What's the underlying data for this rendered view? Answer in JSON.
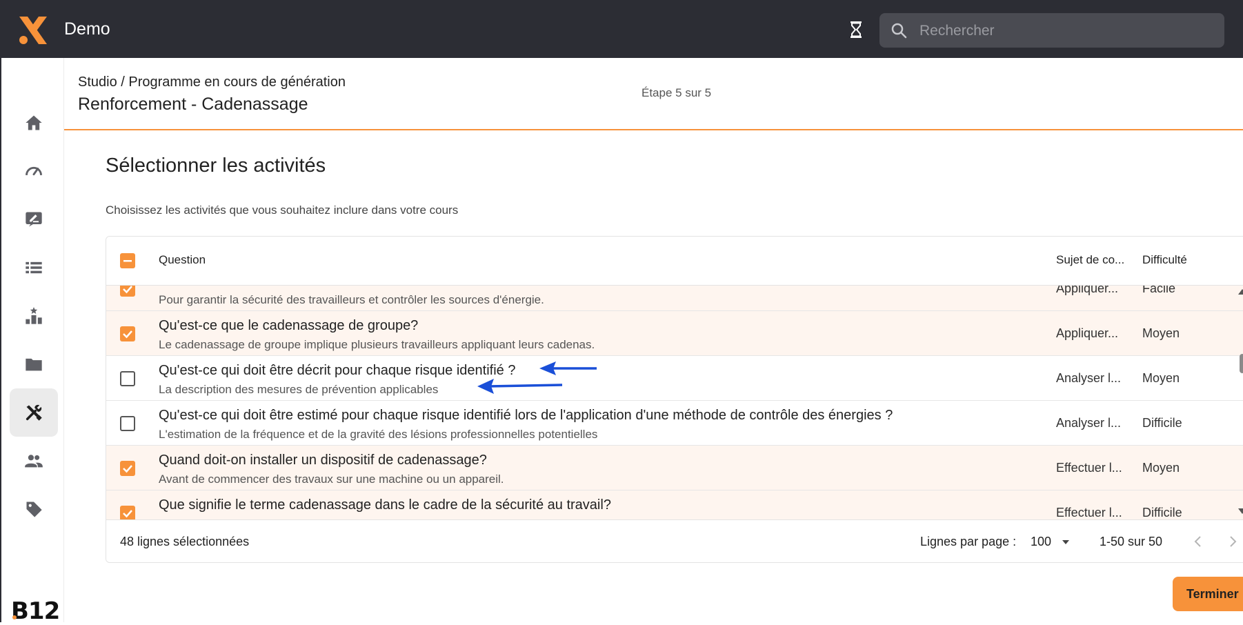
{
  "colors": {
    "accent": "#f7923a",
    "topbar": "#2c2d34",
    "annotation_arrow": "#1a4fd8",
    "selected_row": "#fef5ef"
  },
  "topbar": {
    "app_title": "Demo",
    "search_placeholder": "Rechercher",
    "icons": [
      "app-logo",
      "hourglass-icon",
      "search-icon"
    ]
  },
  "sidebar": {
    "items": [
      {
        "icon": "home-icon",
        "active": false
      },
      {
        "icon": "dashboard-gauge-icon",
        "active": false
      },
      {
        "icon": "edit-note-icon",
        "active": false
      },
      {
        "icon": "list-icon",
        "active": false
      },
      {
        "icon": "leaderboard-icon",
        "active": false
      },
      {
        "icon": "folder-icon",
        "active": false
      },
      {
        "icon": "tools-icon",
        "active": true
      },
      {
        "icon": "people-icon",
        "active": false
      },
      {
        "icon": "tag-icon",
        "active": false
      }
    ],
    "brand": "B12"
  },
  "header": {
    "breadcrumb": "Studio / Programme en cours de génération",
    "title": "Renforcement - Cadenassage",
    "step": "Étape 5 sur 5"
  },
  "main": {
    "section_title": "Sélectionner les activités",
    "section_desc": "Choisissez les activités que vous souhaitez inclure dans votre cours"
  },
  "table": {
    "columns": {
      "question": "Question",
      "subject": "Sujet de co...",
      "difficulty": "Difficulté"
    },
    "rows": [
      {
        "title": "",
        "desc": "Pour garantir la sécurité des travailleurs et contrôler les sources d'énergie.",
        "subject": "Appliquer...",
        "difficulty": "Facile",
        "selected": true
      },
      {
        "title": "Qu'est-ce que le cadenassage de groupe?",
        "desc": "Le cadenassage de groupe implique plusieurs travailleurs appliquant leurs cadenas.",
        "subject": "Appliquer...",
        "difficulty": "Moyen",
        "selected": true
      },
      {
        "title": "Qu'est-ce qui doit être décrit pour chaque risque identifié ?",
        "desc": "La description des mesures de prévention applicables",
        "subject": "Analyser l...",
        "difficulty": "Moyen",
        "selected": false
      },
      {
        "title": "Qu'est-ce qui doit être estimé pour chaque risque identifié lors de l'application d'une méthode de contrôle des énergies ?",
        "desc": "L'estimation de la fréquence et de la gravité des lésions professionnelles potentielles",
        "subject": "Analyser l...",
        "difficulty": "Difficile",
        "selected": false
      },
      {
        "title": "Quand doit-on installer un dispositif de cadenassage?",
        "desc": "Avant de commencer des travaux sur une machine ou un appareil.",
        "subject": "Effectuer l...",
        "difficulty": "Moyen",
        "selected": true
      },
      {
        "title": "Que signifie le terme cadenassage dans le cadre de la sécurité au travail?",
        "desc": "",
        "subject": "Effectuer l...",
        "difficulty": "Difficile",
        "selected": true
      }
    ]
  },
  "footer": {
    "selected_count": "48 lignes sélectionnées",
    "rows_per_page_label": "Lignes par page :",
    "rows_per_page_value": "100",
    "range": "1-50 sur 50"
  },
  "actions": {
    "finish": "Terminer"
  }
}
